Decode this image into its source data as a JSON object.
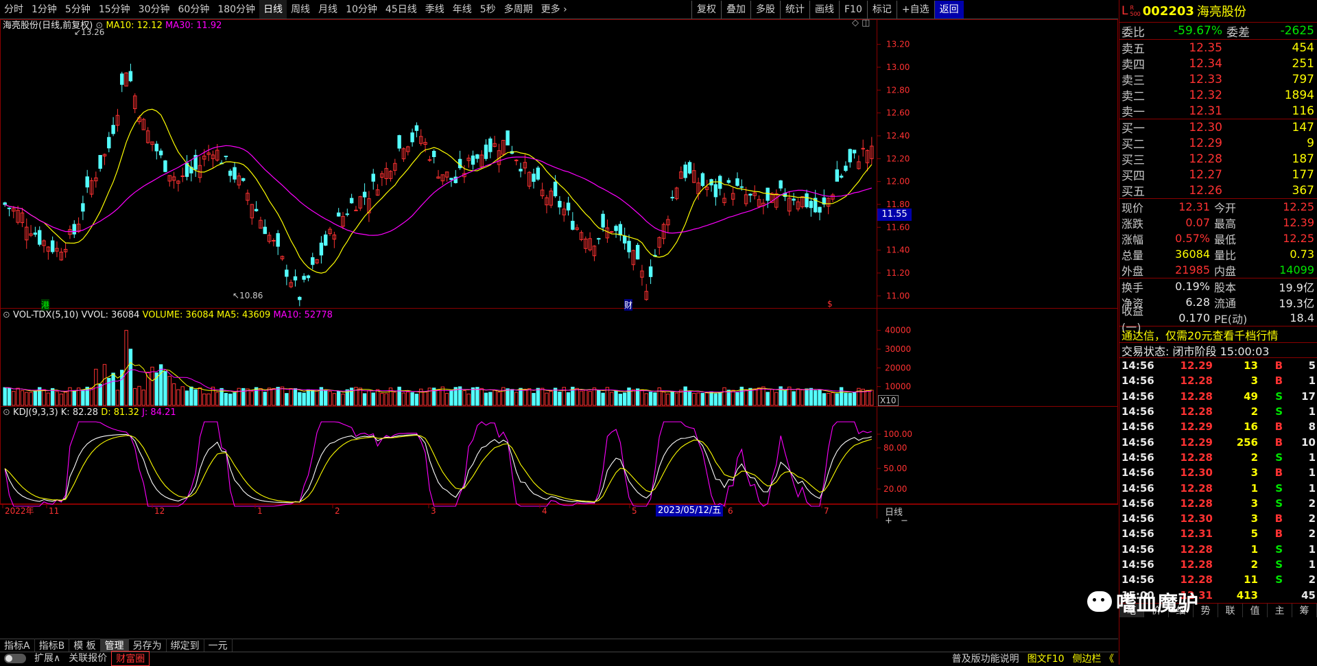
{
  "toolbar": {
    "periods": [
      "分时",
      "1分钟",
      "5分钟",
      "15分钟",
      "30分钟",
      "60分钟",
      "180分钟",
      "日线",
      "周线",
      "月线",
      "10分钟",
      "45日线",
      "季线",
      "年线",
      "5秒",
      "多周期",
      "更多 ›"
    ],
    "active_period": "日线",
    "tools": [
      "复权",
      "叠加",
      "多股",
      "统计",
      "画线",
      "F10",
      "标记",
      "+自选",
      "返回"
    ]
  },
  "price_pane": {
    "title": "海亮股份(日线,前复权)",
    "ma10_label": "MA10: 12.12",
    "ma30_label": "MA30: 11.92",
    "y_ticks": [
      "13.20",
      "13.00",
      "12.80",
      "12.60",
      "12.40",
      "12.20",
      "12.00",
      "11.80",
      "11.60",
      "11.40",
      "11.20",
      "11.00"
    ],
    "high_label": "13.26",
    "low_label": "10.86",
    "price_tag": "11.55",
    "markers": {
      "gang": "港",
      "cai": "财",
      "dollar": "$"
    }
  },
  "volume_pane": {
    "title": "VOL-TDX(5,10)",
    "vvol": "VVOL: 36084",
    "volume": "VOLUME: 36084",
    "ma5": "MA5: 43609",
    "ma10": "MA10: 52778",
    "y_ticks": [
      "40000",
      "30000",
      "20000",
      "10000"
    ],
    "unit_tag": "X10"
  },
  "kdj_pane": {
    "title": "KDJ(9,3,3)",
    "k": "K: 82.28",
    "d": "D: 81.32",
    "j": "J: 84.21",
    "y_ticks": [
      "100.00",
      "80.00",
      "50.00",
      "20.00"
    ]
  },
  "x_axis": {
    "labels": [
      "2022年",
      "11",
      "12",
      "1",
      "2",
      "3",
      "4",
      "5",
      "6",
      "7"
    ],
    "cursor_date": "2023/05/12/五",
    "period_tag": "日线"
  },
  "bottom_bar_1": [
    "指标A",
    "指标B",
    "模 板",
    "管理",
    "另存为",
    "绑定到",
    "一元"
  ],
  "bottom_bar_1_active": "管理",
  "bottom_bar_2": [
    "扩展∧",
    "关联报价",
    "财富圈"
  ],
  "bottom_right_links": [
    "普及版功能说明",
    "图文F10",
    "侧边栏 《"
  ],
  "stock": {
    "code": "002203",
    "name": "海亮股份",
    "badge_top": "R",
    "badge_bottom": "500",
    "prefix": "L"
  },
  "order_ratio": {
    "label1": "委比",
    "value1": "-59.67%",
    "label2": "委差",
    "value2": "-2625"
  },
  "sell_levels": [
    {
      "label": "卖五",
      "price": "12.35",
      "vol": "454"
    },
    {
      "label": "卖四",
      "price": "12.34",
      "vol": "251"
    },
    {
      "label": "卖三",
      "price": "12.33",
      "vol": "797"
    },
    {
      "label": "卖二",
      "price": "12.32",
      "vol": "1894"
    },
    {
      "label": "卖一",
      "price": "12.31",
      "vol": "116"
    }
  ],
  "buy_levels": [
    {
      "label": "买一",
      "price": "12.30",
      "vol": "147"
    },
    {
      "label": "买二",
      "price": "12.29",
      "vol": "9"
    },
    {
      "label": "买三",
      "price": "12.28",
      "vol": "187"
    },
    {
      "label": "买四",
      "price": "12.27",
      "vol": "177"
    },
    {
      "label": "买五",
      "price": "12.26",
      "vol": "367"
    }
  ],
  "quote_stats": [
    {
      "l1": "现价",
      "v1": "12.31",
      "l2": "今开",
      "v2": "12.25"
    },
    {
      "l1": "涨跌",
      "v1": "0.07",
      "l2": "最高",
      "v2": "12.39"
    },
    {
      "l1": "涨幅",
      "v1": "0.57%",
      "l2": "最低",
      "v2": "12.25"
    },
    {
      "l1": "总量",
      "v1": "36084",
      "l2": "量比",
      "v2": "0.73"
    },
    {
      "l1": "外盘",
      "v1": "21985",
      "l2": "内盘",
      "v2": "14099"
    }
  ],
  "finance_stats": [
    {
      "l1": "换手",
      "v1": "0.19%",
      "l2": "股本",
      "v2": "19.9亿"
    },
    {
      "l1": "净资",
      "v1": "6.28",
      "l2": "流通",
      "v2": "19.3亿"
    },
    {
      "l1": "收益(一)",
      "v1": "0.170",
      "l2": "PE(动)",
      "v2": "18.4"
    }
  ],
  "promo": "通达信，仅需20元查看千档行情",
  "trade_status": "交易状态: 闭市阶段 15:00:03",
  "ticks": [
    {
      "t": "14:56",
      "p": "12.29",
      "v": "13",
      "s": "B",
      "n": "5"
    },
    {
      "t": "14:56",
      "p": "12.28",
      "v": "3",
      "s": "B",
      "n": "1"
    },
    {
      "t": "14:56",
      "p": "12.28",
      "v": "49",
      "s": "S",
      "n": "17"
    },
    {
      "t": "14:56",
      "p": "12.28",
      "v": "2",
      "s": "S",
      "n": "1"
    },
    {
      "t": "14:56",
      "p": "12.29",
      "v": "16",
      "s": "B",
      "n": "8"
    },
    {
      "t": "14:56",
      "p": "12.29",
      "v": "256",
      "s": "B",
      "n": "10"
    },
    {
      "t": "14:56",
      "p": "12.28",
      "v": "2",
      "s": "S",
      "n": "1"
    },
    {
      "t": "14:56",
      "p": "12.30",
      "v": "3",
      "s": "B",
      "n": "1"
    },
    {
      "t": "14:56",
      "p": "12.28",
      "v": "1",
      "s": "S",
      "n": "1"
    },
    {
      "t": "14:56",
      "p": "12.28",
      "v": "3",
      "s": "S",
      "n": "2"
    },
    {
      "t": "14:56",
      "p": "12.30",
      "v": "3",
      "s": "B",
      "n": "2"
    },
    {
      "t": "14:56",
      "p": "12.31",
      "v": "5",
      "s": "B",
      "n": "2"
    },
    {
      "t": "14:56",
      "p": "12.28",
      "v": "1",
      "s": "S",
      "n": "1"
    },
    {
      "t": "14:56",
      "p": "12.28",
      "v": "2",
      "s": "S",
      "n": "1"
    },
    {
      "t": "14:56",
      "p": "12.28",
      "v": "11",
      "s": "S",
      "n": "2"
    },
    {
      "t": "15:00",
      "p": "12.31",
      "v": "413",
      "s": "",
      "n": "45"
    }
  ],
  "rp_tabs": [
    "笔",
    "价",
    "细",
    "势",
    "联",
    "值",
    "主",
    "筹"
  ],
  "rp_tab_active": "笔",
  "watermark": "嗜血魔驴",
  "colors": {
    "up": "#ff3232",
    "down": "#54ffff",
    "ma10": "#ffff00",
    "ma30": "#ff00ff",
    "k": "#ffffff",
    "d": "#ffff00",
    "j": "#ff00ff",
    "border": "#8b0000"
  },
  "chart_data": {
    "type": "candlestick",
    "title": "海亮股份(日线,前复权)",
    "symbol": "002203",
    "x_labels": [
      "2022年",
      "11",
      "12",
      "1",
      "2",
      "3",
      "4",
      "5",
      "6",
      "7"
    ],
    "price_ylim": [
      10.86,
      13.26
    ],
    "highest": 13.26,
    "lowest": 10.86,
    "candles_ohlc_sampled": [
      [
        12.0,
        12.1,
        11.7,
        11.8
      ],
      [
        11.8,
        11.9,
        11.6,
        11.7
      ],
      [
        11.7,
        11.9,
        11.4,
        11.5
      ],
      [
        11.5,
        11.7,
        11.3,
        11.4
      ],
      [
        11.4,
        11.6,
        11.2,
        11.55
      ],
      [
        11.55,
        12.1,
        11.5,
        12.0
      ],
      [
        12.0,
        12.4,
        11.9,
        12.3
      ],
      [
        12.3,
        13.26,
        12.2,
        13.0
      ],
      [
        13.0,
        13.1,
        12.4,
        12.5
      ],
      [
        12.5,
        12.6,
        12.1,
        12.2
      ],
      [
        12.2,
        12.3,
        11.9,
        12.0
      ],
      [
        12.0,
        12.2,
        11.9,
        12.1
      ],
      [
        12.1,
        12.4,
        12.0,
        12.3
      ],
      [
        12.3,
        12.35,
        12.0,
        12.1
      ],
      [
        12.1,
        12.2,
        11.8,
        11.9
      ],
      [
        11.9,
        12.0,
        11.5,
        11.6
      ],
      [
        11.6,
        11.7,
        11.2,
        11.3
      ],
      [
        11.3,
        11.4,
        10.86,
        11.0
      ],
      [
        11.0,
        11.4,
        10.95,
        11.3
      ],
      [
        11.3,
        11.7,
        11.2,
        11.6
      ],
      [
        11.6,
        11.9,
        11.5,
        11.8
      ],
      [
        11.8,
        12.0,
        11.6,
        11.9
      ],
      [
        11.9,
        12.2,
        11.8,
        12.1
      ],
      [
        12.1,
        12.4,
        12.0,
        12.35
      ],
      [
        12.35,
        12.55,
        12.2,
        12.4
      ],
      [
        12.4,
        12.45,
        12.0,
        12.1
      ],
      [
        12.1,
        12.2,
        11.9,
        12.0
      ],
      [
        12.0,
        12.3,
        11.95,
        12.2
      ],
      [
        12.2,
        12.45,
        12.1,
        12.3
      ],
      [
        12.3,
        12.45,
        12.2,
        12.35
      ],
      [
        12.35,
        12.4,
        12.0,
        12.1
      ],
      [
        12.1,
        12.2,
        11.8,
        11.9
      ],
      [
        11.9,
        12.0,
        11.7,
        11.8
      ],
      [
        11.8,
        11.9,
        11.5,
        11.6
      ],
      [
        11.6,
        11.7,
        11.4,
        11.5
      ],
      [
        11.5,
        11.7,
        11.4,
        11.6
      ],
      [
        11.6,
        11.7,
        11.3,
        11.4
      ],
      [
        11.4,
        11.5,
        11.0,
        11.1
      ],
      [
        11.1,
        11.7,
        11.05,
        11.6
      ],
      [
        11.6,
        12.2,
        11.5,
        12.1
      ],
      [
        12.1,
        12.25,
        11.9,
        12.0
      ],
      [
        12.0,
        12.1,
        11.8,
        11.9
      ],
      [
        11.9,
        12.05,
        11.8,
        11.95
      ],
      [
        11.95,
        12.1,
        11.8,
        11.85
      ],
      [
        11.85,
        12.0,
        11.7,
        11.8
      ],
      [
        11.8,
        11.95,
        11.6,
        11.9
      ],
      [
        11.9,
        12.05,
        11.75,
        11.85
      ],
      [
        11.85,
        11.95,
        11.5,
        11.7
      ],
      [
        11.7,
        12.1,
        11.65,
        12.0
      ],
      [
        12.0,
        12.3,
        11.95,
        12.2
      ],
      [
        12.2,
        12.39,
        12.15,
        12.31
      ]
    ],
    "ma10_last": 12.12,
    "ma30_last": 11.92,
    "volume_ylim": [
      0,
      40000
    ],
    "volume_last": 36084,
    "vol_ma5_last": 43609,
    "vol_ma10_last": 52778,
    "kdj_ylim": [
      0,
      120
    ],
    "kdj_last": {
      "K": 82.28,
      "D": 81.32,
      "J": 84.21
    }
  }
}
